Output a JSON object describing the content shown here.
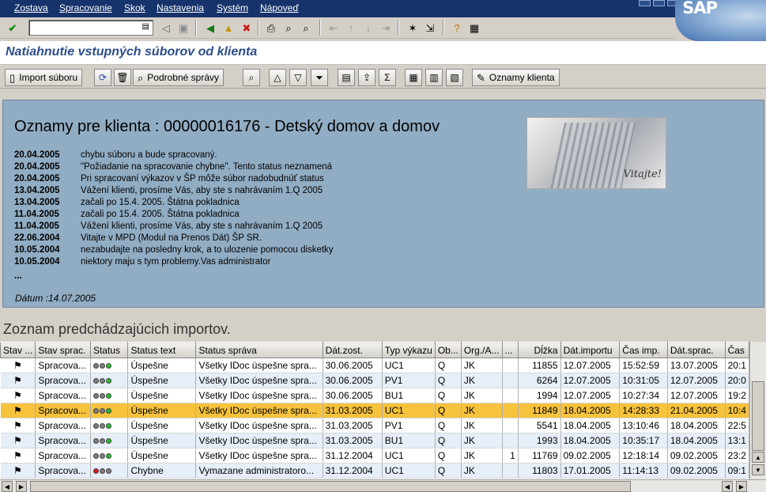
{
  "menu": [
    "Zostava",
    "Spracovanie",
    "Skok",
    "Nastavenia",
    "Systém",
    "Nápoveď"
  ],
  "brand": "SAP",
  "title": "Natiahnutie vstupných súborov od klienta",
  "appbar": {
    "import_label": "Import súboru",
    "details_label": "Podrobné správy",
    "notices_label": "Oznamy klienta"
  },
  "news": {
    "heading": "Oznamy pre klienta : 00000016176 - Detský domov a domov",
    "items": [
      {
        "date": "20.04.2005",
        "text": "chybu súboru a bude spracovaný."
      },
      {
        "date": "20.04.2005",
        "text": "\"Požiadanie na spracovanie chybne\". Tento status neznamená"
      },
      {
        "date": "20.04.2005",
        "text": "Pri spracovaní výkazov v ŠP môže súbor nadobudnúť status"
      },
      {
        "date": "13.04.2005",
        "text": "Vážení klienti, prosíme Vás, aby ste s nahrávaním 1.Q 2005"
      },
      {
        "date": "13.04.2005",
        "text": "začali po 15.4. 2005. Štátna pokladnica"
      },
      {
        "date": "11.04.2005",
        "text": "začali po 15.4. 2005. Štátna pokladnica"
      },
      {
        "date": "11.04.2005",
        "text": "Vážení klienti, prosíme Vás, aby ste s nahrávaním 1.Q 2005"
      },
      {
        "date": "22.06.2004",
        "text": "Vitajte v MPD (Modul na Prenos Dát) ŠP SR."
      },
      {
        "date": "10.05.2004",
        "text": "nezabudajte na posledny krok, a to ulozenie pomocou disketky"
      },
      {
        "date": "10.05.2004",
        "text": "niektory maju s tym problemy.Vas administrator"
      }
    ],
    "ellipsis": "...",
    "datum": "Dátum :14.07.2005",
    "image_caption": "Vitajte!"
  },
  "history": {
    "title": "Zoznam predchádzajúcich importov.",
    "columns": [
      "Stav ...",
      "Stav sprac.",
      "Status",
      "Status text",
      "Status správa",
      "Dát.zost.",
      "Typ výkazu",
      "Ob...",
      "Org./A...",
      "...",
      "Dĺžka",
      "Dát.importu",
      "Čas imp.",
      "Dát.sprac.",
      "Čas"
    ],
    "rows": [
      {
        "stav": "Spracova...",
        "lights": "ggg",
        "text": "Úspešne",
        "msg": "Všetky IDoc úspešne spra...",
        "dzost": "30.06.2005",
        "typ": "UC1",
        "ob": "Q",
        "org": "JK",
        "x": "",
        "len": "11855",
        "dimp": "12.07.2005",
        "cimp": "15:52:59",
        "dspr": "13.07.2005",
        "cas": "20:1"
      },
      {
        "stav": "Spracova...",
        "lights": "ggg",
        "text": "Úspešne",
        "msg": "Všetky IDoc úspešne spra...",
        "dzost": "30.06.2005",
        "typ": "PV1",
        "ob": "Q",
        "org": "JK",
        "x": "",
        "len": "6264",
        "dimp": "12.07.2005",
        "cimp": "10:31:05",
        "dspr": "12.07.2005",
        "cas": "20:0"
      },
      {
        "stav": "Spracova...",
        "lights": "ggg",
        "text": "Úspešne",
        "msg": "Všetky IDoc úspešne spra...",
        "dzost": "30.06.2005",
        "typ": "BU1",
        "ob": "Q",
        "org": "JK",
        "x": "",
        "len": "1994",
        "dimp": "12.07.2005",
        "cimp": "10:27:34",
        "dspr": "12.07.2005",
        "cas": "19:2"
      },
      {
        "stav": "Spracova...",
        "lights": "ggg",
        "text": "Úspešne",
        "msg": "Všetky IDoc úspešne spra...",
        "dzost": "31.03.2005",
        "typ": "UC1",
        "ob": "Q",
        "org": "JK",
        "x": "",
        "len": "11849",
        "dimp": "18.04.2005",
        "cimp": "14:28:33",
        "dspr": "21.04.2005",
        "cas": "10:4"
      },
      {
        "stav": "Spracova...",
        "lights": "ggg",
        "text": "Úspešne",
        "msg": "Všetky IDoc úspešne spra...",
        "dzost": "31.03.2005",
        "typ": "PV1",
        "ob": "Q",
        "org": "JK",
        "x": "",
        "len": "5541",
        "dimp": "18.04.2005",
        "cimp": "13:10:46",
        "dspr": "18.04.2005",
        "cas": "22:5"
      },
      {
        "stav": "Spracova...",
        "lights": "ggg",
        "text": "Úspešne",
        "msg": "Všetky IDoc úspešne spra...",
        "dzost": "31.03.2005",
        "typ": "BU1",
        "ob": "Q",
        "org": "JK",
        "x": "",
        "len": "1993",
        "dimp": "18.04.2005",
        "cimp": "10:35:17",
        "dspr": "18.04.2005",
        "cas": "13:1"
      },
      {
        "stav": "Spracova...",
        "lights": "ggg",
        "text": "Úspešne",
        "msg": "Všetky IDoc úspešne spra...",
        "dzost": "31.12.2004",
        "typ": "UC1",
        "ob": "Q",
        "org": "JK",
        "x": "1",
        "len": "11769",
        "dimp": "09.02.2005",
        "cimp": "12:18:14",
        "dspr": "09.02.2005",
        "cas": "23:2"
      },
      {
        "stav": "Spracova...",
        "lights": "r",
        "text": "Chybne",
        "msg": "Vymazane administratoro...",
        "dzost": "31.12.2004",
        "typ": "UC1",
        "ob": "Q",
        "org": "JK",
        "x": "",
        "len": "11803",
        "dimp": "17.01.2005",
        "cimp": "11:14:13",
        "dspr": "09.02.2005",
        "cas": "09:1"
      }
    ],
    "selected_row": 3
  },
  "colors": {
    "menubar": "#17336b",
    "title": "#2c4d8a",
    "news_bg": "#91adc4",
    "selected": "#f7c23c"
  },
  "icons": [
    "enter-icon",
    "save-icon",
    "back-icon",
    "exit-icon",
    "cancel-icon",
    "print-icon",
    "find-icon",
    "find-next-icon",
    "help-icon",
    "layout-icon",
    "refresh-icon",
    "delete-icon",
    "magnifier-icon",
    "sort-asc-icon",
    "sort-desc-icon",
    "filter-icon",
    "sum-icon",
    "export-icon",
    "grid-icon",
    "flag-icon"
  ]
}
